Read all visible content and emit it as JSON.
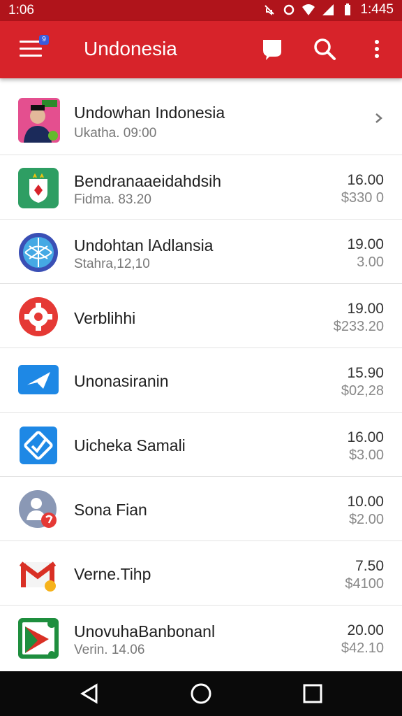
{
  "status_bar": {
    "time": "1:06",
    "clock_right": "1:445"
  },
  "app_bar": {
    "title": "Undonesia",
    "menu_badge": "9"
  },
  "items": [
    {
      "name": "Undowhan Indonesia",
      "sub": "Ukatha. 09:00",
      "val1": "",
      "val2": "",
      "icon": "portrait-icon"
    },
    {
      "name": "Bendranaaeidahdsih",
      "sub": "Fidma. 83.20",
      "val1": "16.00",
      "val2": "$330 0",
      "icon": "flag-shield-icon"
    },
    {
      "name": "Undohtan lAdlansia",
      "sub": "Stahra,12,10",
      "val1": "19.00",
      "val2": "3.00",
      "icon": "globe-icon"
    },
    {
      "name": "Verblihhi",
      "sub": "",
      "val1": "19.00",
      "val2": "$233.20",
      "icon": "gear-icon"
    },
    {
      "name": "Unonasiranin",
      "sub": "",
      "val1": "15.90",
      "val2": "$02,28",
      "icon": "mail-icon"
    },
    {
      "name": "Uicheka Samali",
      "sub": "",
      "val1": "16.00",
      "val2": "$3.00",
      "icon": "check-icon"
    },
    {
      "name": "Sona Fian",
      "sub": "",
      "val1": "10.00",
      "val2": "$2.00",
      "icon": "contact-icon"
    },
    {
      "name": "Verne.Tihp",
      "sub": "",
      "val1": "7.50",
      "val2": "$4100",
      "icon": "gmail-icon"
    },
    {
      "name": "UnovuhaBanbonanl",
      "sub": "Verin. 14.06",
      "val1": "20.00",
      "val2": "$42.10",
      "icon": "play-icon"
    }
  ],
  "colors": {
    "primary": "#d7232a",
    "status": "#b0141b"
  }
}
